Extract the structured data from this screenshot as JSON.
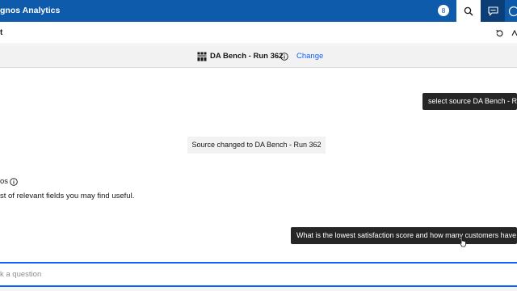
{
  "header": {
    "app_title": "gnos Analytics",
    "notification_count": "8",
    "icons": [
      "search-icon",
      "chat-icon",
      "help-icon"
    ],
    "colors": {
      "header_bg": "#0f5bab",
      "active_btn_bg": "#0c3f77"
    }
  },
  "subbar": {
    "label": "t",
    "icons": [
      "reset-icon",
      "more-icon"
    ]
  },
  "source": {
    "name": "DA Bench - Run 362",
    "change_label": "Change",
    "icon": "dataset-icon",
    "info_icon": "info-icon"
  },
  "conversation": {
    "user_message_1": "select source DA Bench - Ru",
    "system_message": "Source changed to DA Bench - Run 362",
    "assistant_title": "os",
    "assistant_text": "st of relevant fields you may find useful.",
    "user_message_2": "What is the lowest satisfaction score and how many customers have i"
  },
  "input": {
    "placeholder": "k a question",
    "value": ""
  }
}
